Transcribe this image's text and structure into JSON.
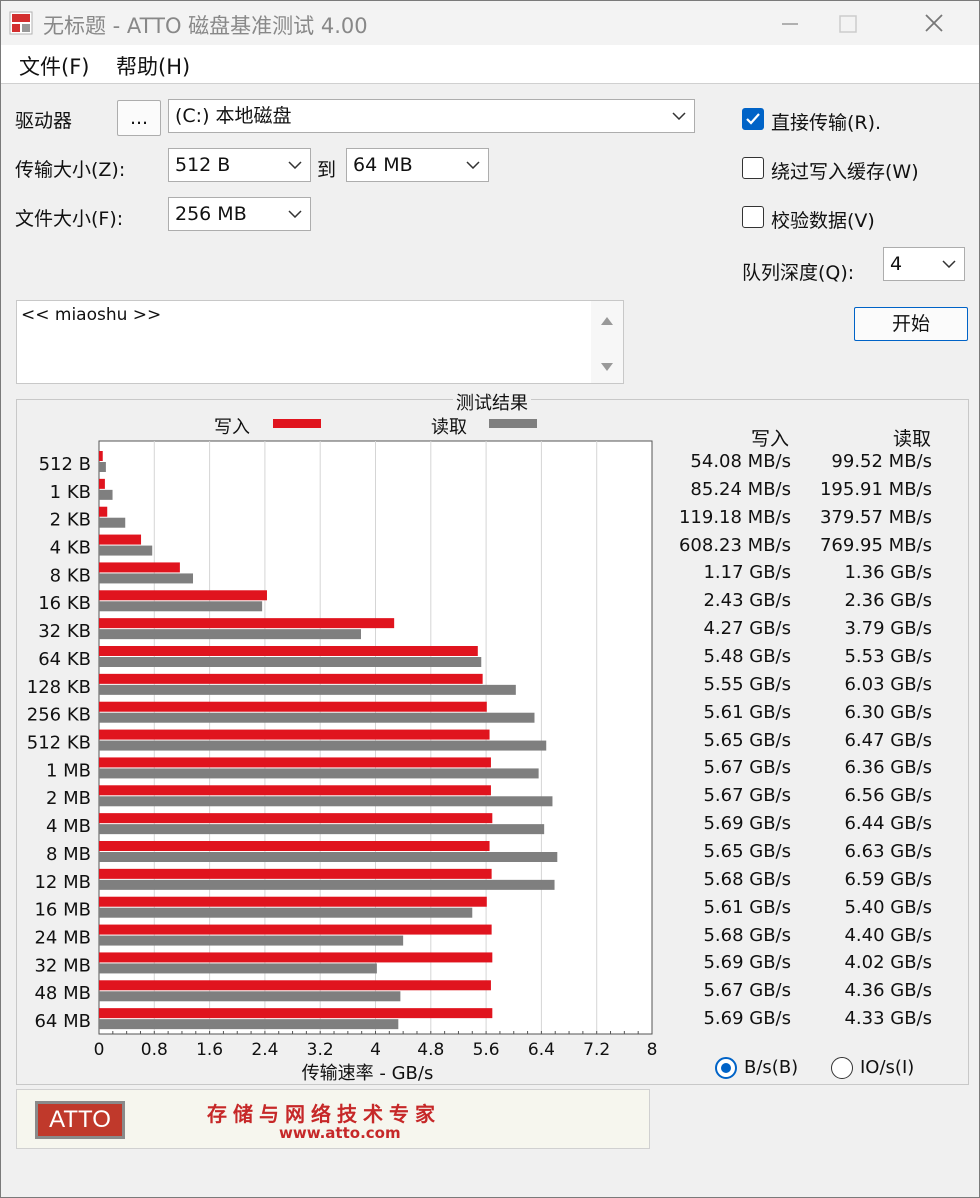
{
  "window": {
    "title": "无标题 - ATTO 磁盘基准测试 4.00"
  },
  "menu": [
    {
      "label": "文件(F)"
    },
    {
      "label": "帮助(H)"
    }
  ],
  "drive": {
    "label": "驱动器",
    "browse": "...",
    "value": "(C:) 本地磁盘"
  },
  "transfer": {
    "label": "传输大小(Z):",
    "from": "512 B",
    "to_label": "到",
    "to": "64 MB"
  },
  "filesize": {
    "label": "文件大小(F):",
    "value": "256 MB"
  },
  "options": {
    "direct": {
      "label": "直接传输(R).",
      "checked": true
    },
    "bypass_cache": {
      "label": "绕过写入缓存(W)",
      "checked": false
    },
    "verify": {
      "label": "校验数据(V)",
      "checked": false
    },
    "queue_label": "队列深度(Q):",
    "queue_value": "4"
  },
  "start_button": "开始",
  "description": "<< miaoshu >>",
  "results": {
    "title": "测试结果",
    "legend_write": "写入",
    "legend_read": "读取",
    "col_write": "写入",
    "col_read": "读取",
    "write_text": [
      "54.08 MB/s",
      "85.24 MB/s",
      "119.18 MB/s",
      "608.23 MB/s",
      "1.17 GB/s",
      "2.43 GB/s",
      "4.27 GB/s",
      "5.48 GB/s",
      "5.55 GB/s",
      "5.61 GB/s",
      "5.65 GB/s",
      "5.67 GB/s",
      "5.67 GB/s",
      "5.69 GB/s",
      "5.65 GB/s",
      "5.68 GB/s",
      "5.61 GB/s",
      "5.68 GB/s",
      "5.69 GB/s",
      "5.67 GB/s",
      "5.69 GB/s"
    ],
    "read_text": [
      "99.52 MB/s",
      "195.91 MB/s",
      "379.57 MB/s",
      "769.95 MB/s",
      "1.36 GB/s",
      "2.36 GB/s",
      "3.79 GB/s",
      "5.53 GB/s",
      "6.03 GB/s",
      "6.30 GB/s",
      "6.47 GB/s",
      "6.36 GB/s",
      "6.56 GB/s",
      "6.44 GB/s",
      "6.63 GB/s",
      "6.59 GB/s",
      "5.40 GB/s",
      "4.40 GB/s",
      "4.02 GB/s",
      "4.36 GB/s",
      "4.33 GB/s"
    ]
  },
  "units": {
    "bytes": "B/s(B)",
    "io": "IO/s(I)",
    "selected": "bytes"
  },
  "banner": {
    "logo": "ATTO",
    "slogan": "存储与网络技术专家",
    "url": "www.atto.com"
  },
  "colors": {
    "write": "#e0141e",
    "read": "#7f7f7f",
    "accent": "#0063c7"
  },
  "chart_data": {
    "type": "bar",
    "orientation": "horizontal",
    "categories": [
      "512 B",
      "1 KB",
      "2 KB",
      "4 KB",
      "8 KB",
      "16 KB",
      "32 KB",
      "64 KB",
      "128 KB",
      "256 KB",
      "512 KB",
      "1 MB",
      "2 MB",
      "4 MB",
      "8 MB",
      "12 MB",
      "16 MB",
      "24 MB",
      "32 MB",
      "48 MB",
      "64 MB"
    ],
    "series": [
      {
        "name": "写入",
        "values": [
          0.05408,
          0.08524,
          0.11918,
          0.60823,
          1.17,
          2.43,
          4.27,
          5.48,
          5.55,
          5.61,
          5.65,
          5.67,
          5.67,
          5.69,
          5.65,
          5.68,
          5.61,
          5.68,
          5.69,
          5.67,
          5.69
        ]
      },
      {
        "name": "读取",
        "values": [
          0.09952,
          0.19591,
          0.37957,
          0.76995,
          1.36,
          2.36,
          3.79,
          5.53,
          6.03,
          6.3,
          6.47,
          6.36,
          6.56,
          6.44,
          6.63,
          6.59,
          5.4,
          4.4,
          4.02,
          4.36,
          4.33
        ]
      }
    ],
    "xlabel": "传输速率 - GB/s",
    "xlim": [
      0,
      8
    ],
    "xticks": [
      "0",
      "0.8",
      "1.6",
      "2.4",
      "3.2",
      "4",
      "4.8",
      "5.6",
      "6.4",
      "7.2",
      "8"
    ],
    "grid": true,
    "legend": "top"
  }
}
